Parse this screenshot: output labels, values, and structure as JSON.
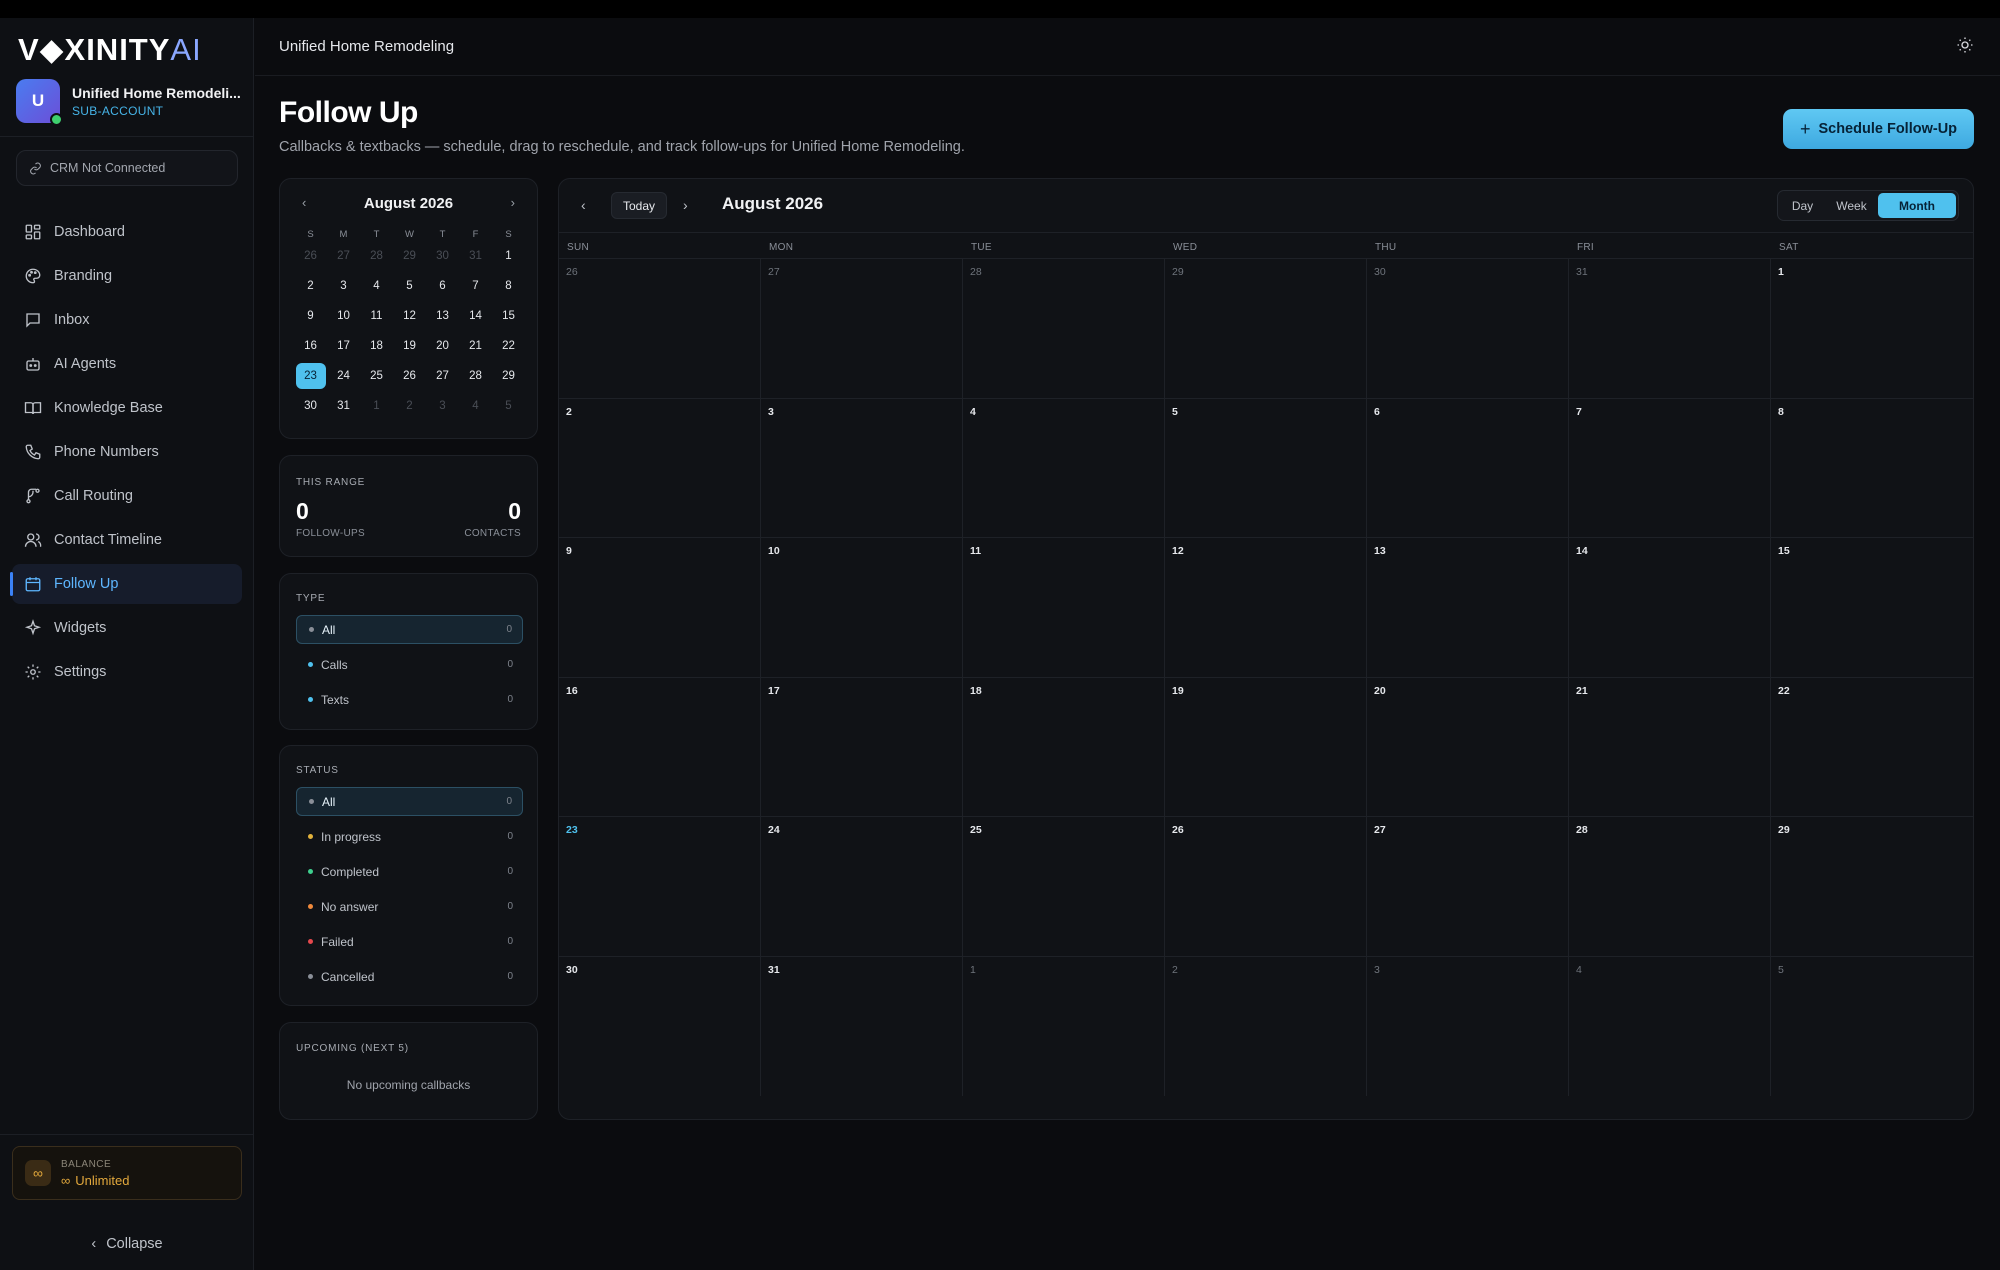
{
  "brand": {
    "logo_main": "V◆XINITY",
    "logo_ai": "AI"
  },
  "account": {
    "initial": "U",
    "name": "Unified Home Remodeli...",
    "role": "SUB-ACCOUNT"
  },
  "crm_status": "CRM Not Connected",
  "nav": [
    {
      "label": "Dashboard",
      "icon": "dashboard-icon"
    },
    {
      "label": "Branding",
      "icon": "palette-icon"
    },
    {
      "label": "Inbox",
      "icon": "message-icon"
    },
    {
      "label": "AI Agents",
      "icon": "bot-icon"
    },
    {
      "label": "Knowledge Base",
      "icon": "book-icon"
    },
    {
      "label": "Phone Numbers",
      "icon": "phone-icon"
    },
    {
      "label": "Call Routing",
      "icon": "routing-icon"
    },
    {
      "label": "Contact Timeline",
      "icon": "users-icon"
    },
    {
      "label": "Follow Up",
      "icon": "calendar-icon",
      "active": true
    },
    {
      "label": "Widgets",
      "icon": "sparkle-icon"
    },
    {
      "label": "Settings",
      "icon": "gear-icon"
    }
  ],
  "balance": {
    "label": "BALANCE",
    "value": "Unlimited"
  },
  "collapse_label": "Collapse",
  "header": {
    "title": "Unified Home Remodeling"
  },
  "page": {
    "title": "Follow Up",
    "subtitle": "Callbacks & textbacks — schedule, drag to reschedule, and track follow-ups for Unified Home Remodeling.",
    "schedule_button": "Schedule Follow-Up"
  },
  "mini_calendar": {
    "title": "August 2026",
    "dow": [
      "S",
      "M",
      "T",
      "W",
      "T",
      "F",
      "S"
    ],
    "weeks": [
      [
        "26",
        "27",
        "28",
        "29",
        "30",
        "31",
        "1"
      ],
      [
        "2",
        "3",
        "4",
        "5",
        "6",
        "7",
        "8"
      ],
      [
        "9",
        "10",
        "11",
        "12",
        "13",
        "14",
        "15"
      ],
      [
        "16",
        "17",
        "18",
        "19",
        "20",
        "21",
        "22"
      ],
      [
        "23",
        "24",
        "25",
        "26",
        "27",
        "28",
        "29"
      ],
      [
        "30",
        "31",
        "1",
        "2",
        "3",
        "4",
        "5"
      ]
    ],
    "today": "23"
  },
  "range": {
    "label": "THIS RANGE",
    "followups": "0",
    "followups_label": "FOLLOW-UPS",
    "contacts": "0",
    "contacts_label": "CONTACTS"
  },
  "type_filter": {
    "label": "TYPE",
    "items": [
      {
        "label": "All",
        "count": "0",
        "color": "#8a8f98",
        "active": true
      },
      {
        "label": "Calls",
        "count": "0",
        "color": "#4fc1ee"
      },
      {
        "label": "Texts",
        "count": "0",
        "color": "#4fc1ee"
      }
    ]
  },
  "status_filter": {
    "label": "STATUS",
    "items": [
      {
        "label": "All",
        "count": "0",
        "color": "#8a8f98",
        "active": true
      },
      {
        "label": "In progress",
        "count": "0",
        "color": "#e2b23c"
      },
      {
        "label": "Completed",
        "count": "0",
        "color": "#3ecf8e"
      },
      {
        "label": "No answer",
        "count": "0",
        "color": "#f08a3c"
      },
      {
        "label": "Failed",
        "count": "0",
        "color": "#e5484d"
      },
      {
        "label": "Cancelled",
        "count": "0",
        "color": "#8a8f98"
      }
    ]
  },
  "upcoming": {
    "label": "UPCOMING (NEXT 5)",
    "empty": "No upcoming callbacks"
  },
  "calendar": {
    "today_label": "Today",
    "title": "August 2026",
    "views": [
      "Day",
      "Week",
      "Month"
    ],
    "active_view": "Month",
    "dow": [
      "SUN",
      "MON",
      "TUE",
      "WED",
      "THU",
      "FRI",
      "SAT"
    ],
    "weeks": [
      [
        "26",
        "27",
        "28",
        "29",
        "30",
        "31",
        "1"
      ],
      [
        "2",
        "3",
        "4",
        "5",
        "6",
        "7",
        "8"
      ],
      [
        "9",
        "10",
        "11",
        "12",
        "13",
        "14",
        "15"
      ],
      [
        "16",
        "17",
        "18",
        "19",
        "20",
        "21",
        "22"
      ],
      [
        "23",
        "24",
        "25",
        "26",
        "27",
        "28",
        "29"
      ],
      [
        "30",
        "31",
        "1",
        "2",
        "3",
        "4",
        "5"
      ]
    ]
  },
  "colors": {
    "accent": "#4fc1ee",
    "background": "#0b0c0f",
    "panel": "#101216"
  }
}
